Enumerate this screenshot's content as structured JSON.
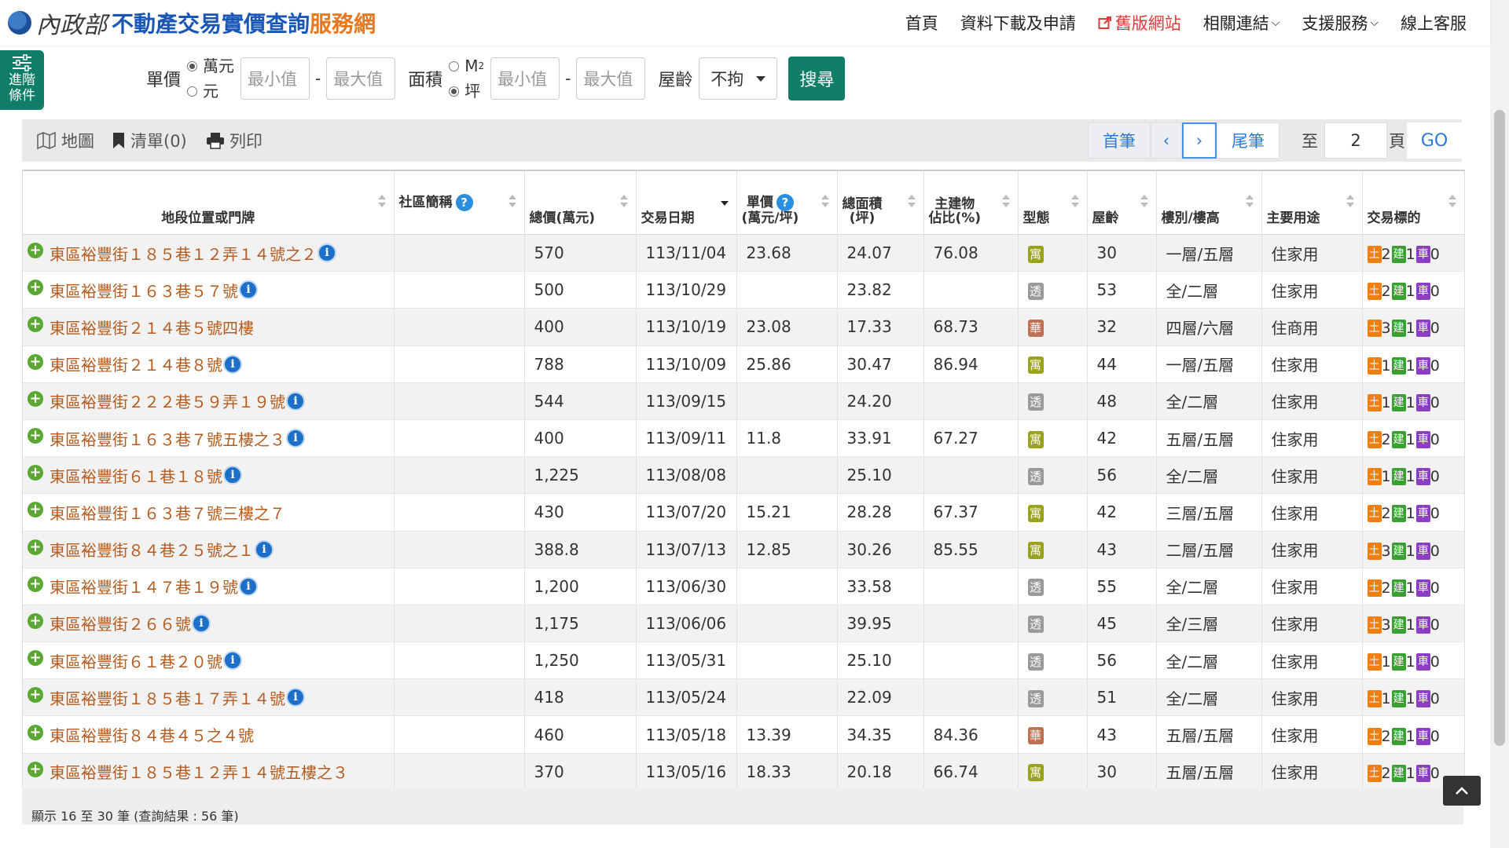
{
  "header": {
    "logo_ministry": "內政部",
    "logo_title": "不動產交易實價查詢",
    "logo_suffix": "服務網",
    "nav": [
      {
        "label": "首頁"
      },
      {
        "label": "資料下載及申請"
      },
      {
        "label": "舊版網站",
        "color": "#e13a3a"
      },
      {
        "label": "相關連結"
      },
      {
        "label": "支援服務"
      },
      {
        "label": "線上客服"
      }
    ]
  },
  "adv_tab": {
    "line1": "進階",
    "line2": "條件"
  },
  "filters": {
    "unit_price_label": "單價",
    "unit_price_options": [
      "萬元",
      "元"
    ],
    "unit_price_selected": "萬元",
    "min_placeholder": "最小值",
    "max_placeholder": "最大值",
    "area_label": "面積",
    "area_option_m2": "M",
    "area_option_ping": "坪",
    "area_selected": "坪",
    "age_label": "屋齡",
    "age_value": "不拘",
    "search_label": "搜尋"
  },
  "toolbar": {
    "map": "地圖",
    "list": "清單(0)",
    "print": "列印"
  },
  "pager": {
    "first": "首筆",
    "last": "尾筆",
    "to": "至",
    "page_value": "2",
    "page": "頁",
    "go": "GO"
  },
  "table": {
    "headers": {
      "address": "地段位置或門牌",
      "community": "社區簡稱",
      "total_price": "總價(萬元)",
      "date": "交易日期",
      "unit_price_1": "單價",
      "unit_price_2": "(萬元/坪)",
      "area_1": "總面積",
      "area_2": "(坪)",
      "main_ratio_1": "主建物",
      "main_ratio_2": "佔比(%)",
      "type": "型態",
      "age": "屋齡",
      "floor": "樓別/樓高",
      "usage": "主要用途",
      "target": "交易標的"
    },
    "labels": {
      "land": "土",
      "building": "建",
      "car": "車"
    },
    "rows": [
      {
        "address": "東區裕豐街１８５巷１２弄１４號之２",
        "info": true,
        "community": "",
        "total": "570",
        "date": "113/11/04",
        "unit": "23.68",
        "area": "24.07",
        "ratio": "76.08",
        "type": "寓",
        "type_color": "olive",
        "age": "30",
        "floor": "一層/五層",
        "usage": "住家用",
        "land": "2",
        "bld": "1",
        "car": "0"
      },
      {
        "address": "東區裕豐街１６３巷５７號",
        "info": true,
        "community": "",
        "total": "500",
        "date": "113/10/29",
        "unit": "",
        "area": "23.82",
        "ratio": "",
        "type": "透",
        "type_color": "gray",
        "age": "53",
        "floor": "全/二層",
        "usage": "住家用",
        "land": "2",
        "bld": "1",
        "car": "0"
      },
      {
        "address": "東區裕豐街２１４巷５號四樓",
        "info": false,
        "community": "",
        "total": "400",
        "date": "113/10/19",
        "unit": "23.08",
        "area": "17.33",
        "ratio": "68.73",
        "type": "華",
        "type_color": "brown",
        "age": "32",
        "floor": "四層/六層",
        "usage": "住商用",
        "land": "3",
        "bld": "1",
        "car": "0"
      },
      {
        "address": "東區裕豐街２１４巷８號",
        "info": true,
        "community": "",
        "total": "788",
        "date": "113/10/09",
        "unit": "25.86",
        "area": "30.47",
        "ratio": "86.94",
        "type": "寓",
        "type_color": "olive",
        "age": "44",
        "floor": "一層/五層",
        "usage": "住家用",
        "land": "1",
        "bld": "1",
        "car": "0"
      },
      {
        "address": "東區裕豐街２２２巷５９弄１９號",
        "info": true,
        "community": "",
        "total": "544",
        "date": "113/09/15",
        "unit": "",
        "area": "24.20",
        "ratio": "",
        "type": "透",
        "type_color": "gray",
        "age": "48",
        "floor": "全/二層",
        "usage": "住家用",
        "land": "1",
        "bld": "1",
        "car": "0"
      },
      {
        "address": "東區裕豐街１６３巷７號五樓之３",
        "info": true,
        "community": "",
        "total": "400",
        "date": "113/09/11",
        "unit": "11.8",
        "area": "33.91",
        "ratio": "67.27",
        "type": "寓",
        "type_color": "olive",
        "age": "42",
        "floor": "五層/五層",
        "usage": "住家用",
        "land": "2",
        "bld": "1",
        "car": "0"
      },
      {
        "address": "東區裕豐街６１巷１８號",
        "info": true,
        "community": "",
        "total": "1,225",
        "date": "113/08/08",
        "unit": "",
        "area": "25.10",
        "ratio": "",
        "type": "透",
        "type_color": "gray",
        "age": "56",
        "floor": "全/二層",
        "usage": "住家用",
        "land": "1",
        "bld": "1",
        "car": "0"
      },
      {
        "address": "東區裕豐街１６３巷７號三樓之７",
        "info": false,
        "community": "",
        "total": "430",
        "date": "113/07/20",
        "unit": "15.21",
        "area": "28.28",
        "ratio": "67.37",
        "type": "寓",
        "type_color": "olive",
        "age": "42",
        "floor": "三層/五層",
        "usage": "住家用",
        "land": "2",
        "bld": "1",
        "car": "0"
      },
      {
        "address": "東區裕豐街８４巷２５號之１",
        "info": true,
        "community": "",
        "total": "388.8",
        "date": "113/07/13",
        "unit": "12.85",
        "area": "30.26",
        "ratio": "85.55",
        "type": "寓",
        "type_color": "olive",
        "age": "43",
        "floor": "二層/五層",
        "usage": "住家用",
        "land": "3",
        "bld": "1",
        "car": "0"
      },
      {
        "address": "東區裕豐街１４７巷１９號",
        "info": true,
        "community": "",
        "total": "1,200",
        "date": "113/06/30",
        "unit": "",
        "area": "33.58",
        "ratio": "",
        "type": "透",
        "type_color": "gray",
        "age": "55",
        "floor": "全/二層",
        "usage": "住家用",
        "land": "2",
        "bld": "1",
        "car": "0"
      },
      {
        "address": "東區裕豐街２６６號",
        "info": true,
        "community": "",
        "total": "1,175",
        "date": "113/06/06",
        "unit": "",
        "area": "39.95",
        "ratio": "",
        "type": "透",
        "type_color": "gray",
        "age": "45",
        "floor": "全/三層",
        "usage": "住家用",
        "land": "3",
        "bld": "1",
        "car": "0"
      },
      {
        "address": "東區裕豐街６１巷２０號",
        "info": true,
        "community": "",
        "total": "1,250",
        "date": "113/05/31",
        "unit": "",
        "area": "25.10",
        "ratio": "",
        "type": "透",
        "type_color": "gray",
        "age": "56",
        "floor": "全/二層",
        "usage": "住家用",
        "land": "1",
        "bld": "1",
        "car": "0"
      },
      {
        "address": "東區裕豐街１８５巷１７弄１４號",
        "info": true,
        "community": "",
        "total": "418",
        "date": "113/05/24",
        "unit": "",
        "area": "22.09",
        "ratio": "",
        "type": "透",
        "type_color": "gray",
        "age": "51",
        "floor": "全/二層",
        "usage": "住家用",
        "land": "1",
        "bld": "1",
        "car": "0"
      },
      {
        "address": "東區裕豐街８４巷４５之４號",
        "info": false,
        "community": "",
        "total": "460",
        "date": "113/05/18",
        "unit": "13.39",
        "area": "34.35",
        "ratio": "84.36",
        "type": "華",
        "type_color": "brown",
        "age": "43",
        "floor": "五層/五層",
        "usage": "住家用",
        "land": "2",
        "bld": "1",
        "car": "0"
      },
      {
        "address": "東區裕豐街１８５巷１２弄１４號五樓之３",
        "info": false,
        "community": "",
        "total": "370",
        "date": "113/05/16",
        "unit": "18.33",
        "area": "20.18",
        "ratio": "66.74",
        "type": "寓",
        "type_color": "olive",
        "age": "30",
        "floor": "五層/五層",
        "usage": "住家用",
        "land": "2",
        "bld": "1",
        "car": "0"
      }
    ]
  },
  "footer": {
    "summary": "顯示 16 至 30 筆 (查詢結果 : 56 筆)"
  }
}
